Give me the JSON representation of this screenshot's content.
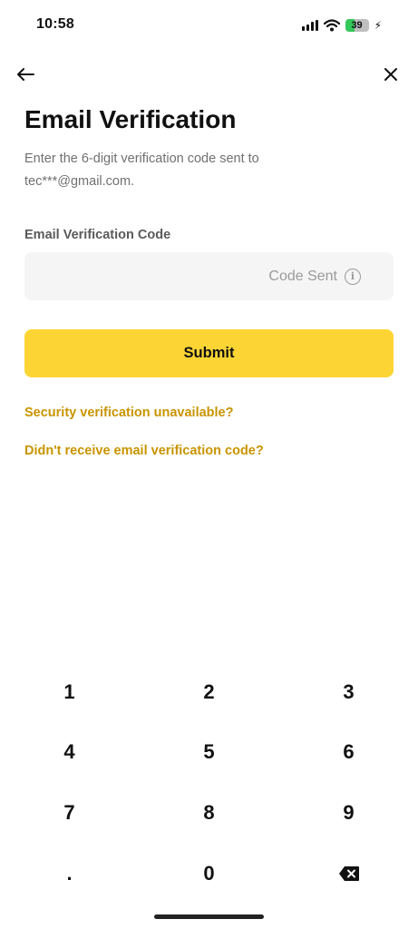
{
  "status_bar": {
    "time": "10:58",
    "battery_level": "39",
    "battery_fraction": 0.39,
    "icons": [
      "cellular-signal-icon",
      "wifi-icon",
      "battery-icon",
      "charging-bolt-icon"
    ]
  },
  "nav": {
    "back_icon": "arrow-left-icon",
    "close_icon": "close-icon"
  },
  "page": {
    "title": "Email Verification",
    "description": "Enter the 6-digit verification code sent to tec***@gmail.com."
  },
  "form": {
    "field_label": "Email Verification Code",
    "code_value": "",
    "code_placeholder": "",
    "code_sent_label": "Code Sent",
    "info_icon": "info-icon",
    "submit_label": "Submit"
  },
  "links": {
    "security_unavailable": "Security verification unavailable?",
    "no_email_code": "Didn't receive email verification code?"
  },
  "keypad": {
    "keys": [
      "1",
      "2",
      "3",
      "4",
      "5",
      "6",
      "7",
      "8",
      "9",
      ".",
      "0",
      "backspace-icon"
    ]
  },
  "colors": {
    "accent": "#fcd535",
    "link": "#c99400",
    "input_bg": "#f5f5f5",
    "muted_text": "#707070"
  }
}
